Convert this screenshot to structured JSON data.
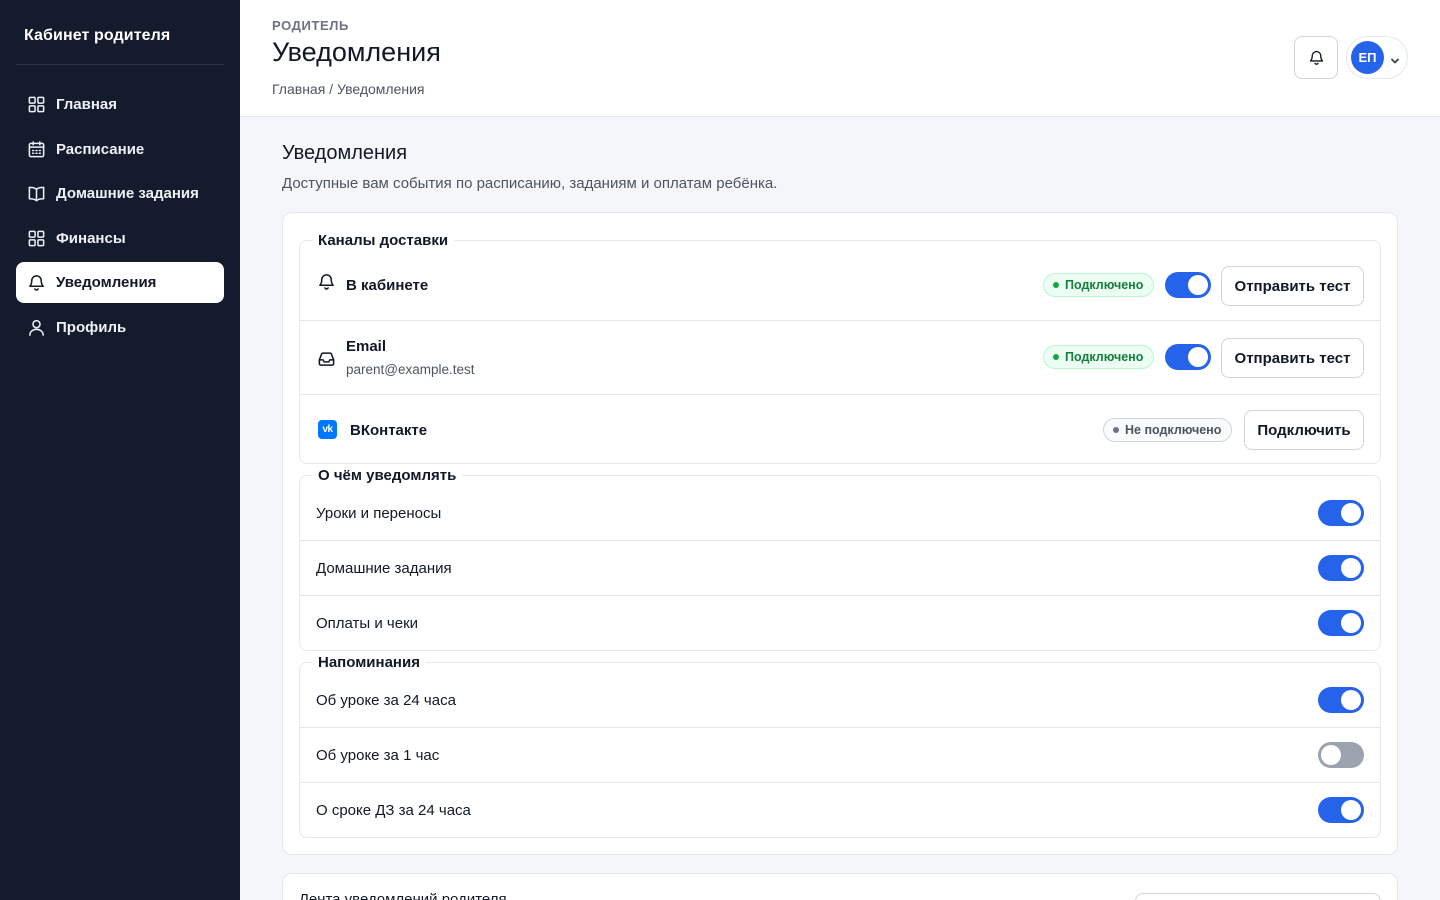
{
  "sidebar": {
    "brand": "Кабинет родителя",
    "items": [
      {
        "label": "Главная",
        "icon": "grid-icon",
        "active": false
      },
      {
        "label": "Расписание",
        "icon": "calendar-icon",
        "active": false
      },
      {
        "label": "Домашние задания",
        "icon": "book-icon",
        "active": false
      },
      {
        "label": "Финансы",
        "icon": "grid-icon",
        "active": false
      },
      {
        "label": "Уведомления",
        "icon": "bell-icon",
        "active": true
      },
      {
        "label": "Профиль",
        "icon": "user-icon",
        "active": false
      }
    ]
  },
  "header": {
    "eyebrow": "РОДИТЕЛЬ",
    "title": "Уведомления",
    "breadcrumb": "Главная / Уведомления",
    "avatar_initials": "ЕП"
  },
  "main": {
    "title": "Уведомления",
    "subtitle": "Доступные вам события по расписанию, заданиям и оплатам ребёнка.",
    "channels": {
      "legend": "Каналы доставки",
      "items": [
        {
          "name": "В кабинете",
          "sub": "",
          "status": "Подключено",
          "connected": true,
          "toggle": true,
          "action": "Отправить тест",
          "icon": "bell-icon"
        },
        {
          "name": "Email",
          "sub": "parent@example.test",
          "status": "Подключено",
          "connected": true,
          "toggle": true,
          "action": "Отправить тест",
          "icon": "inbox-icon"
        },
        {
          "name": "ВКонтакте",
          "sub": "",
          "status": "Не подключено",
          "connected": false,
          "toggle": null,
          "action": "Подключить",
          "icon": "vk-icon"
        }
      ]
    },
    "topics": {
      "legend": "О чём уведомлять",
      "items": [
        {
          "label": "Уроки и переносы",
          "enabled": true
        },
        {
          "label": "Домашние задания",
          "enabled": true
        },
        {
          "label": "Оплаты и чеки",
          "enabled": true
        }
      ]
    },
    "reminders": {
      "legend": "Напоминания",
      "items": [
        {
          "label": "Об уроке за 24 часа",
          "enabled": true
        },
        {
          "label": "Об уроке за 1 час",
          "enabled": false
        },
        {
          "label": "О сроке ДЗ за 24 часа",
          "enabled": true
        }
      ]
    },
    "feed": {
      "title": "Лента уведомлений родителя"
    }
  },
  "colors": {
    "sidebar_bg": "#141b2d",
    "accent": "#2563eb",
    "success": "#16a34a",
    "toggle_off": "#9ca3af"
  }
}
